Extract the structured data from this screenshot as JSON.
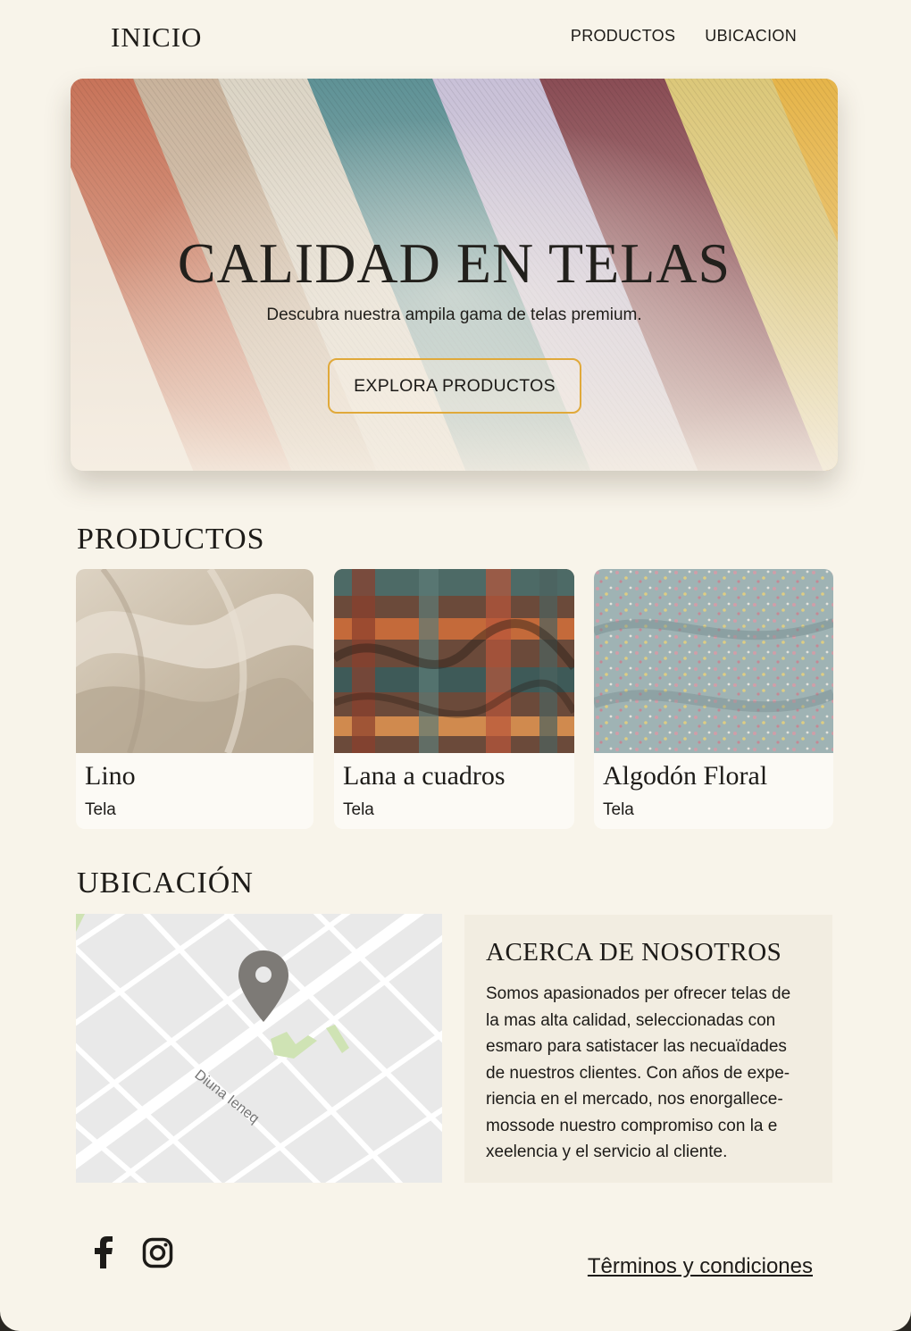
{
  "nav": {
    "logo": "INICIO",
    "links": [
      "PRODUCTOS",
      "UBICACION"
    ]
  },
  "hero": {
    "title": "CALIDAD EN TELAS",
    "subtitle": "Descubra nuestra ampila gama de telas premium.",
    "cta": "EXPLORA PRODUCTOS"
  },
  "products": {
    "heading": "PRODUCTOS",
    "items": [
      {
        "title": "Lino",
        "subtitle": "Tela"
      },
      {
        "title": "Lana a cuadros",
        "subtitle": "Tela"
      },
      {
        "title": "Algodón Floral",
        "subtitle": "Tela"
      }
    ]
  },
  "location": {
    "heading": "UBICACIÓN",
    "street_label": "Diuna Ieneq"
  },
  "about": {
    "title": "ACERCA DE NOSOTROS",
    "lines": [
      "Somos apasionados per ofrecer telas de",
      "la mas alta calidad, seleccionadas con",
      "esmaro para satistacer las necuaïdades",
      "de nuestros clientes. Con años de expe-",
      "riencia en el mercado, nos enorgallece-",
      "mossode nuestro compromiso con la e",
      "xeelencia y el servicio al cliente."
    ]
  },
  "footer": {
    "terms": "Têrminos y condiciones",
    "social_icons": [
      "facebook-icon",
      "instagram-icon"
    ]
  },
  "colors": {
    "background": "#f8f4ea",
    "accent_border": "#e0a93a",
    "text": "#1d1b18",
    "about_panel": "#f2ede1"
  }
}
